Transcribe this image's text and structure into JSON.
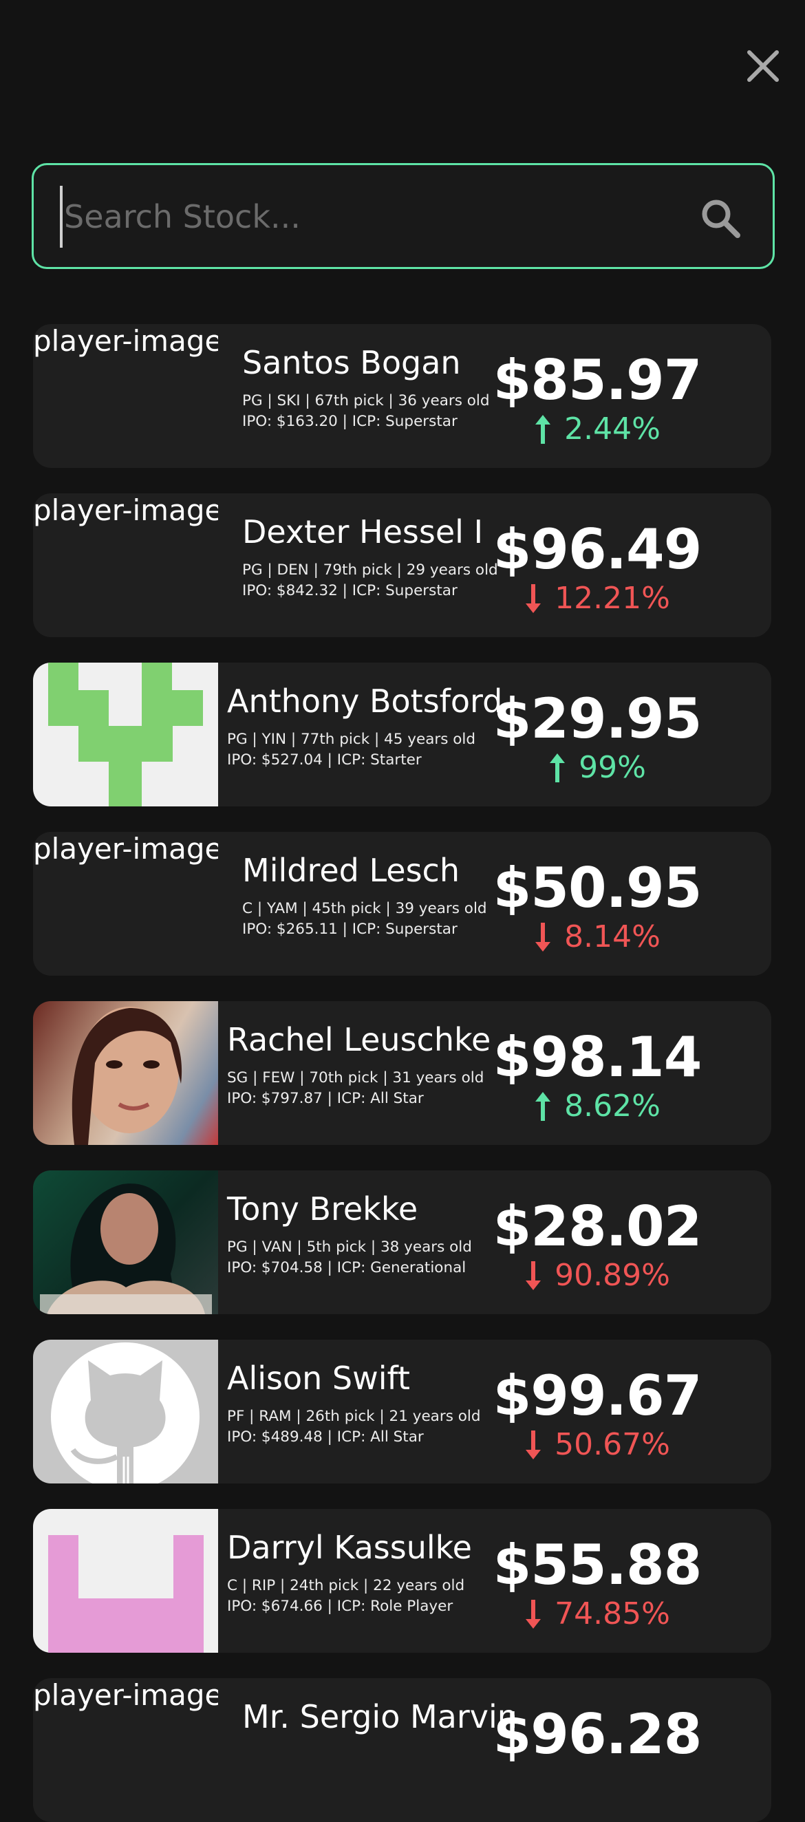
{
  "search": {
    "placeholder": "Search Stock..."
  },
  "colors": {
    "accent": "#5ee3a6",
    "up": "#5ee3a6",
    "down": "#f05555"
  },
  "stocks": [
    {
      "name": "Santos Bogan",
      "meta1": "PG | SKI | 67th pick | 36 years old",
      "meta2": "IPO: $163.20 | ICP: Superstar",
      "price": "$85.97",
      "change": "2.44%",
      "direction": "up",
      "image": "player-image"
    },
    {
      "name": "Dexter Hessel I",
      "meta1": "PG | DEN | 79th pick | 29 years old",
      "meta2": "IPO: $842.32 | ICP: Superstar",
      "price": "$96.49",
      "change": "12.21%",
      "direction": "down",
      "image": "player-image"
    },
    {
      "name": "Anthony Botsford",
      "meta1": "PG | YIN | 77th pick | 45 years old",
      "meta2": "IPO: $527.04 | ICP: Starter",
      "price": "$29.95",
      "change": "99%",
      "direction": "up",
      "image": "green-identicon"
    },
    {
      "name": "Mildred Lesch",
      "meta1": "C | YAM | 45th pick | 39 years old",
      "meta2": "IPO: $265.11 | ICP: Superstar",
      "price": "$50.95",
      "change": "8.14%",
      "direction": "down",
      "image": "player-image"
    },
    {
      "name": "Rachel Leuschke",
      "meta1": "SG | FEW | 70th pick | 31 years old",
      "meta2": "IPO: $797.87 | ICP: All Star",
      "price": "$98.14",
      "change": "8.62%",
      "direction": "up",
      "image": "portrait-photo"
    },
    {
      "name": "Tony Brekke",
      "meta1": "PG | VAN | 5th pick | 38 years old",
      "meta2": "IPO: $704.58 | ICP: Generational",
      "price": "$28.02",
      "change": "90.89%",
      "direction": "down",
      "image": "portrait-photo"
    },
    {
      "name": "Alison Swift",
      "meta1": "PF | RAM | 26th pick | 21 years old",
      "meta2": "IPO: $489.48 | ICP: All Star",
      "price": "$99.67",
      "change": "50.67%",
      "direction": "down",
      "image": "octocat-avatar"
    },
    {
      "name": "Darryl Kassulke",
      "meta1": "C | RIP | 24th pick | 22 years old",
      "meta2": "IPO: $674.66 | ICP: Role Player",
      "price": "$55.88",
      "change": "74.85%",
      "direction": "down",
      "image": "pink-identicon"
    },
    {
      "name": "Mr. Sergio Marvin",
      "meta1": "",
      "meta2": "",
      "price": "$96.28",
      "change": "",
      "direction": "up",
      "image": "player-image"
    }
  ]
}
